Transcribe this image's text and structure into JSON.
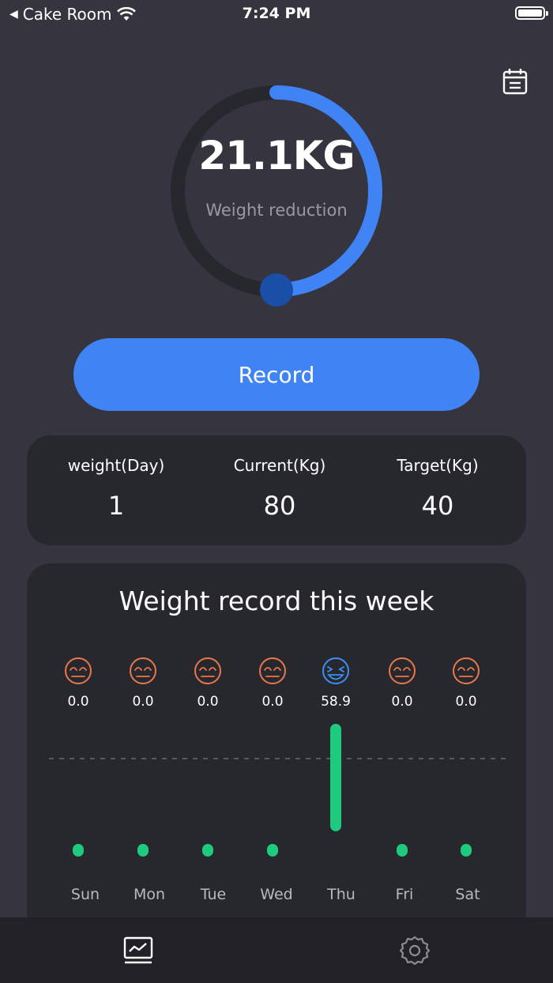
{
  "status": {
    "back_app": "Cake Room",
    "time": "7:24 PM"
  },
  "header": {
    "calendar_icon": "calendar-icon"
  },
  "progress": {
    "value_text": "21.1KG",
    "label": "Weight reduction",
    "fraction": 0.5,
    "track_color": "#27272e",
    "arc_color": "#4083f4",
    "knob_color": "#1a4fa8"
  },
  "record_button": {
    "label": "Record"
  },
  "stats": [
    {
      "label": "weight(Day)",
      "value": "1"
    },
    {
      "label": "Current(Kg)",
      "value": "80"
    },
    {
      "label": "Target(Kg)",
      "value": "40"
    }
  ],
  "week_card": {
    "title": "Weight record this week"
  },
  "chart_data": {
    "type": "bar",
    "categories": [
      "Sun",
      "Mon",
      "Tue",
      "Wed",
      "Thu",
      "Fri",
      "Sat"
    ],
    "values": [
      0.0,
      0.0,
      0.0,
      0.0,
      58.9,
      0.0,
      0.0
    ],
    "value_labels": [
      "0.0",
      "0.0",
      "0.0",
      "0.0",
      "58.9",
      "0.0",
      "0.0"
    ],
    "moods": [
      "neutral",
      "neutral",
      "neutral",
      "neutral",
      "happy",
      "neutral",
      "neutral"
    ],
    "bar_color": "#1ecb7e",
    "neutral_color": "#e9784a",
    "happy_color": "#3d8ff0"
  },
  "tabs": [
    {
      "name": "chart-tab",
      "icon": "chart-icon",
      "selected": true
    },
    {
      "name": "settings-tab",
      "icon": "gear-icon",
      "selected": false
    }
  ]
}
